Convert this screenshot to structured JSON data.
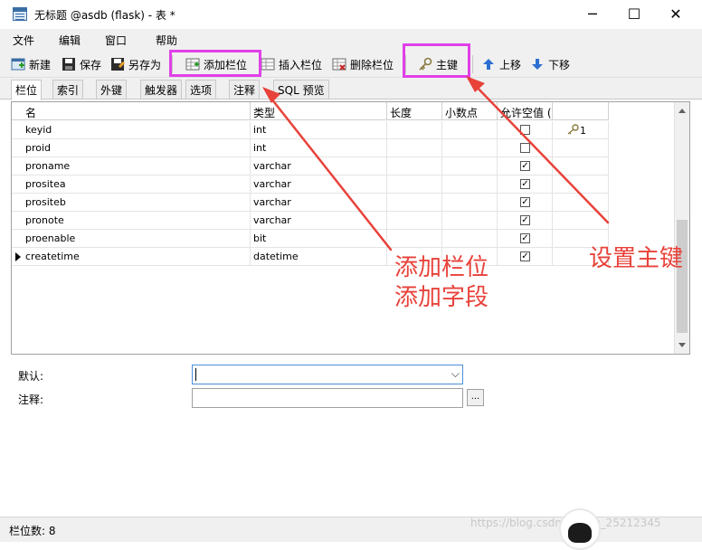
{
  "window": {
    "title": "无标题 @asdb (flask) - 表 *",
    "minimize": "─",
    "maximize": "☐",
    "close": "✕"
  },
  "menu": [
    "文件",
    "编辑",
    "窗口",
    "帮助"
  ],
  "toolbar": {
    "new": "新建",
    "save": "保存",
    "save_as": "另存为",
    "add_field": "添加栏位",
    "insert_field": "插入栏位",
    "delete_field": "删除栏位",
    "primary_key": "主键",
    "move_up": "上移",
    "move_down": "下移"
  },
  "tabs": [
    "栏位",
    "索引",
    "外键",
    "触发器",
    "选项",
    "注释",
    "SQL 预览"
  ],
  "active_tab": "栏位",
  "table": {
    "headers": [
      "名",
      "类型",
      "长度",
      "小数点",
      "允许空值 (",
      ""
    ],
    "rows": [
      {
        "name": "keyid",
        "type": "int",
        "length": "",
        "decimals": "",
        "nullable": false,
        "key": "1",
        "current": false
      },
      {
        "name": "proid",
        "type": "int",
        "length": "",
        "decimals": "",
        "nullable": false,
        "key": "",
        "current": false
      },
      {
        "name": "proname",
        "type": "varchar",
        "length": "",
        "decimals": "",
        "nullable": true,
        "key": "",
        "current": false
      },
      {
        "name": "prositea",
        "type": "varchar",
        "length": "",
        "decimals": "",
        "nullable": true,
        "key": "",
        "current": false
      },
      {
        "name": "prositeb",
        "type": "varchar",
        "length": "",
        "decimals": "",
        "nullable": true,
        "key": "",
        "current": false
      },
      {
        "name": "pronote",
        "type": "varchar",
        "length": "",
        "decimals": "",
        "nullable": true,
        "key": "",
        "current": false
      },
      {
        "name": "proenable",
        "type": "bit",
        "length": "",
        "decimals": "",
        "nullable": true,
        "key": "",
        "current": false
      },
      {
        "name": "createtime",
        "type": "datetime",
        "length": "",
        "decimals": "",
        "nullable": true,
        "key": "",
        "current": true
      }
    ]
  },
  "properties": {
    "default_label": "默认:",
    "default_value": "",
    "comment_label": "注释:",
    "comment_value": "",
    "ellipsis": "..."
  },
  "status": {
    "field_count": "栏位数: 8"
  },
  "watermark": "https://blog.csdn.net/qq_25212345",
  "annotations": {
    "add_field_line1": "添加栏位",
    "add_field_line2": "添加字段",
    "set_primary_key": "设置主键",
    "color": "#e8423a",
    "highlight_color": "#e040e8"
  }
}
